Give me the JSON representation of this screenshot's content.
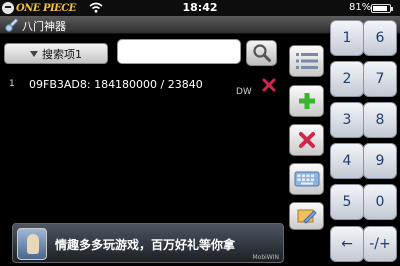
{
  "status_bar": {
    "carrier_logo_text": "ONE PIECE",
    "time": "18:42",
    "battery_percent": "81%",
    "battery_level": 0.81
  },
  "title_bar": {
    "title": "八门神器"
  },
  "search": {
    "dropdown_label": "搜索项1",
    "input_value": "",
    "input_placeholder": ""
  },
  "results": [
    {
      "index": "1",
      "value": "09FB3AD8: 184180000 / 23840",
      "tag": "DW"
    }
  ],
  "tools": [
    {
      "name": "list-icon"
    },
    {
      "name": "add-icon"
    },
    {
      "name": "delete-icon"
    },
    {
      "name": "keyboard-icon"
    },
    {
      "name": "edit-icon"
    }
  ],
  "keypad": {
    "keys": [
      "1",
      "6",
      "2",
      "7",
      "3",
      "8",
      "4",
      "9",
      "5",
      "0",
      "←",
      "-/+"
    ]
  },
  "ad": {
    "text": "情趣多多玩游戏，百万好礼等你拿",
    "brand": "MobiWIN"
  },
  "colors": {
    "accent_green": "#3bb52e",
    "accent_red": "#d2264b",
    "key_text": "#1f3f6e"
  }
}
